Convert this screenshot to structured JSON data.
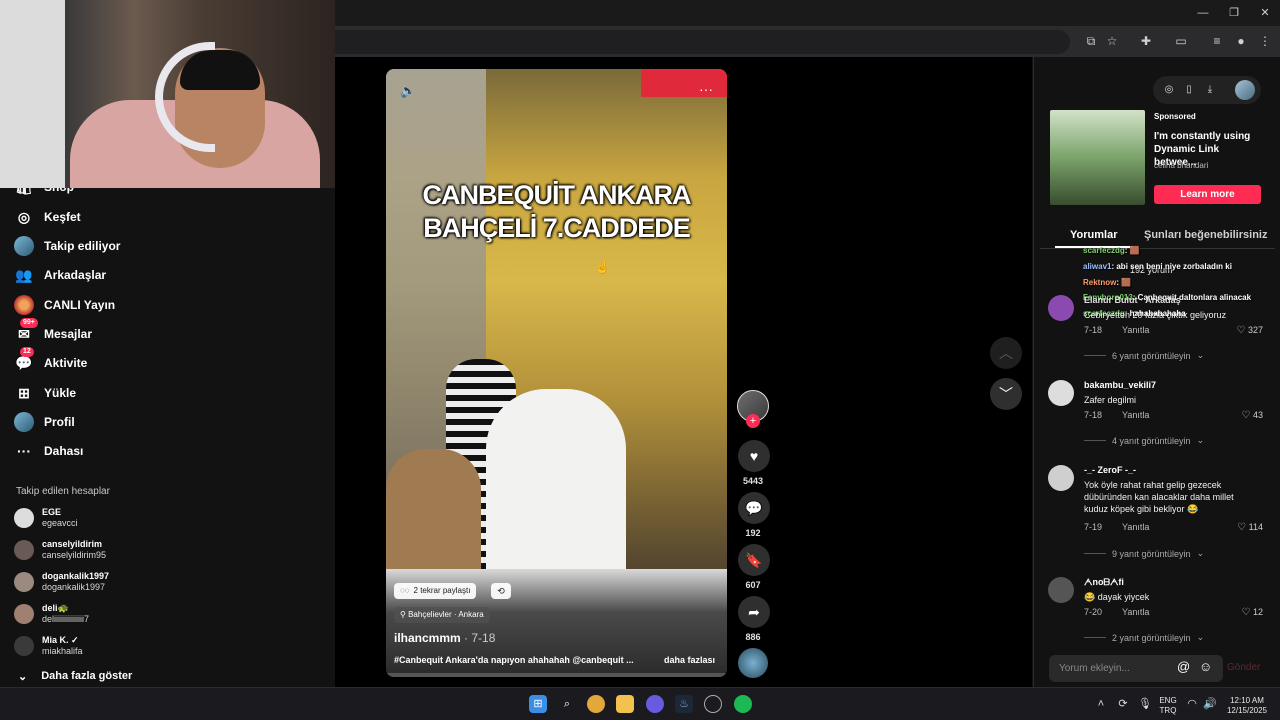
{
  "sidebar": {
    "items": [
      {
        "label": "Shop",
        "icon": "shop-icon"
      },
      {
        "label": "Keşfet",
        "icon": "compass-icon"
      },
      {
        "label": "Takip ediliyor",
        "icon": "following-avatar"
      },
      {
        "label": "Arkadaşlar",
        "icon": "friends-icon"
      },
      {
        "label": "CANLI Yayın",
        "icon": "live-icon"
      },
      {
        "label": "Mesajlar",
        "icon": "messages-icon",
        "badge": "99+"
      },
      {
        "label": "Aktivite",
        "icon": "activity-icon",
        "badge": "12"
      },
      {
        "label": "Yükle",
        "icon": "upload-icon"
      },
      {
        "label": "Profil",
        "icon": "profile-avatar"
      },
      {
        "label": "Dahası",
        "icon": "more-icon"
      }
    ],
    "following_title": "Takip edilen hesaplar",
    "following": [
      {
        "name": "EGE",
        "handle": "egeavcci"
      },
      {
        "name": "canselyildirim",
        "handle": "canselyildirim95"
      },
      {
        "name": "dogankalik1997",
        "handle": "dogankalik1997"
      },
      {
        "name": "deli🐢",
        "handle": "deliiiiiiiiiiiiiii7"
      },
      {
        "name": "Mia K. ✓",
        "handle": "miakhalifa"
      }
    ],
    "show_more": "Daha fazla göster"
  },
  "video": {
    "title_line1": "CANBEQUİT ANKARA",
    "title_line2": "BAHÇELİ 7.CADDEDE",
    "repost_text": "2 tekrar paylaştı",
    "location": "Bahçelievler · Ankara",
    "author": "ilhancmmm",
    "date": "· 7-18",
    "caption": "#Canbequit Ankara'da napıyon ahahahah @canbequit ...",
    "more_label": "daha fazlası",
    "likes": "5443",
    "comments": "192",
    "saves": "607",
    "shares": "886"
  },
  "ad": {
    "sponsored": "Sponsored",
    "text": "I'm constantly using Dynamic Link betwee...",
    "author": "celina bhandari",
    "cta": "Learn more"
  },
  "tabs": {
    "comments": "Yorumlar",
    "likes": "Şunları beğenebilirsiniz"
  },
  "comment_count": "192 yorum",
  "chat": [
    {
      "user": "scarfeczdg",
      "text": ": 🟫"
    },
    {
      "user": "aliwav1",
      "text": ": abi sen beni niye zorbaladın ki"
    },
    {
      "user": "Rektnow",
      "text": ": 🟫"
    },
    {
      "user": "Fenvboro013",
      "text": ": Canbequit daltonlara alinacak"
    },
    {
      "user": "scarfeczdg",
      "text": ": hahahahahaha"
    }
  ],
  "comments": [
    {
      "name": "Elanur Bulut · Arkadaş",
      "text": "Cebiryetten 20 fazla çıktık geliyoruz",
      "date": "7-18",
      "reply": "Yanıtla",
      "likes": "327",
      "replies": "6 yanıt görüntüleyin"
    },
    {
      "name": "bakambu_vekili7",
      "text": "Zafer degilmi",
      "date": "7-18",
      "reply": "Yanıtla",
      "likes": "43",
      "replies": "4 yanıt görüntüleyin"
    },
    {
      "name": "-_- ZeroF -_-",
      "text": "Yok öyle rahat rahat gelip gezecek dübüründen kan alacaklar daha millet kuduz köpek gibi bekliyor 😂",
      "date": "7-19",
      "reply": "Yanıtla",
      "likes": "114",
      "replies": "9 yanıt görüntüleyin"
    },
    {
      "name": "ᗅnoᗷᗅfi",
      "text": "😂 dayak yiycek",
      "date": "7-20",
      "reply": "Yanıtla",
      "likes": "12",
      "replies": "2 yanıt görüntüleyin"
    }
  ],
  "input": {
    "placeholder": "Yorum ekleyin...",
    "send": "Gönder"
  },
  "taskbar": {
    "lang1": "ENG",
    "lang2": "TRQ",
    "time": "12:10 AM",
    "date": "12/15/2025"
  }
}
